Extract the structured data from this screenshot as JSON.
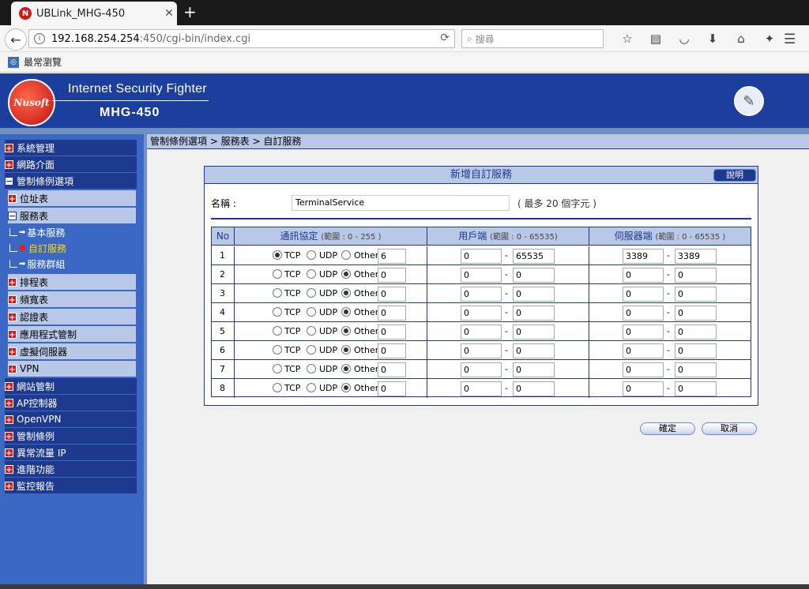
{
  "browser": {
    "tab_title": "UBLink_MHG-450",
    "tab_favicon": "N",
    "url_host": "192.168.254.254",
    "url_rest": ":450/cgi-bin/index.cgi",
    "search_placeholder": "搜尋",
    "bookmark": "最常瀏覽"
  },
  "banner": {
    "logo": "Nusoft",
    "tagline": "Internet Security Fighter",
    "model": "MHG-450"
  },
  "sidebar": {
    "items": [
      {
        "label": "系統管理"
      },
      {
        "label": "網路介面"
      },
      {
        "label": "管制條例選項"
      },
      {
        "label": "位址表"
      },
      {
        "label": "服務表"
      },
      {
        "label": "基本服務"
      },
      {
        "label": "自訂服務"
      },
      {
        "label": "服務群組"
      },
      {
        "label": "排程表"
      },
      {
        "label": "頻寬表"
      },
      {
        "label": "認證表"
      },
      {
        "label": "應用程式管制"
      },
      {
        "label": "虛擬伺服器"
      },
      {
        "label": "VPN"
      },
      {
        "label": "網站管制"
      },
      {
        "label": "AP控制器"
      },
      {
        "label": "OpenVPN"
      },
      {
        "label": "管制條例"
      },
      {
        "label": "異常流量 IP"
      },
      {
        "label": "進階功能"
      },
      {
        "label": "監控報告"
      }
    ]
  },
  "breadcrumb": "管制條例選項 > 服務表 > 自訂服務",
  "panel": {
    "title": "新增自訂服務",
    "help_button": "說明",
    "name_label": "名稱 :",
    "name_value": "TerminalService",
    "name_hint": "( 最多 20 個字元 )",
    "headers": {
      "no": "No",
      "protocol": "通訊協定",
      "protocol_range": "(範圍 : 0 - 255 )",
      "client": "用戶端",
      "client_range": "(範圍 : 0 - 65535)",
      "server": "伺服器端",
      "server_range": "(範圍 : 0 - 65535 )"
    },
    "radio_labels": {
      "tcp": "TCP",
      "udp": "UDP",
      "other": "Other"
    },
    "dash": "-",
    "rows": [
      {
        "no": "1",
        "selected": "tcp",
        "other": "6",
        "client_from": "0",
        "client_to": "65535",
        "server_from": "3389",
        "server_to": "3389"
      },
      {
        "no": "2",
        "selected": "other",
        "other": "0",
        "client_from": "0",
        "client_to": "0",
        "server_from": "0",
        "server_to": "0"
      },
      {
        "no": "3",
        "selected": "other",
        "other": "0",
        "client_from": "0",
        "client_to": "0",
        "server_from": "0",
        "server_to": "0"
      },
      {
        "no": "4",
        "selected": "other",
        "other": "0",
        "client_from": "0",
        "client_to": "0",
        "server_from": "0",
        "server_to": "0"
      },
      {
        "no": "5",
        "selected": "other",
        "other": "0",
        "client_from": "0",
        "client_to": "0",
        "server_from": "0",
        "server_to": "0"
      },
      {
        "no": "6",
        "selected": "other",
        "other": "0",
        "client_from": "0",
        "client_to": "0",
        "server_from": "0",
        "server_to": "0"
      },
      {
        "no": "7",
        "selected": "other",
        "other": "0",
        "client_from": "0",
        "client_to": "0",
        "server_from": "0",
        "server_to": "0"
      },
      {
        "no": "8",
        "selected": "other",
        "other": "0",
        "client_from": "0",
        "client_to": "0",
        "server_from": "0",
        "server_to": "0"
      }
    ]
  },
  "buttons": {
    "ok": "確定",
    "cancel": "取消"
  },
  "colors": {
    "brand_blue": "#1c3e9c",
    "header_bg": "#b8c8e6",
    "accent_red": "#d41a1a"
  }
}
